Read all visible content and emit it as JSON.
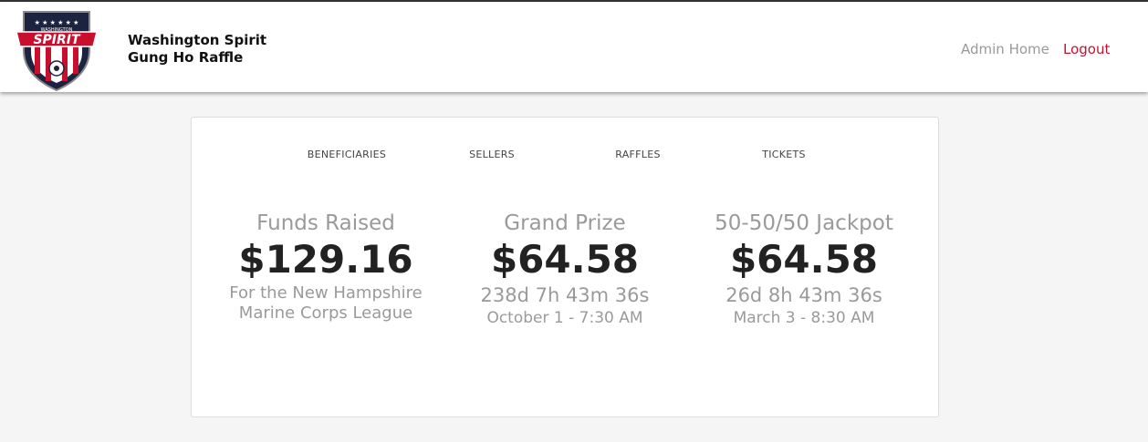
{
  "header": {
    "brand_line1": "Washington Spirit",
    "brand_line2": "Gung Ho Raffle",
    "logo_text": "SPIRIT",
    "logo_subtext": "WASHINGTON",
    "nav_admin_home": "Admin Home",
    "nav_logout": "Logout"
  },
  "tabs": [
    "BENEFICIARIES",
    "SELLERS",
    "RAFFLES",
    "TICKETS"
  ],
  "stats": {
    "funds": {
      "title": "Funds Raised",
      "value": "$129.16",
      "sub_line1": "For the New Hampshire",
      "sub_line2": "Marine Corps League"
    },
    "grand": {
      "title": "Grand Prize",
      "value": "$64.58",
      "countdown": "238d 7h 43m 36s",
      "date": "October 1 - 7:30 AM"
    },
    "jackpot": {
      "title": "50-50/50 Jackpot",
      "value": "$64.58",
      "countdown": "26d 8h 43m 36s",
      "date": "March 3 - 8:30 AM"
    }
  },
  "colors": {
    "accent_red": "#c8102e",
    "navy": "#1c2340",
    "muted_text": "#9a9a9a"
  }
}
